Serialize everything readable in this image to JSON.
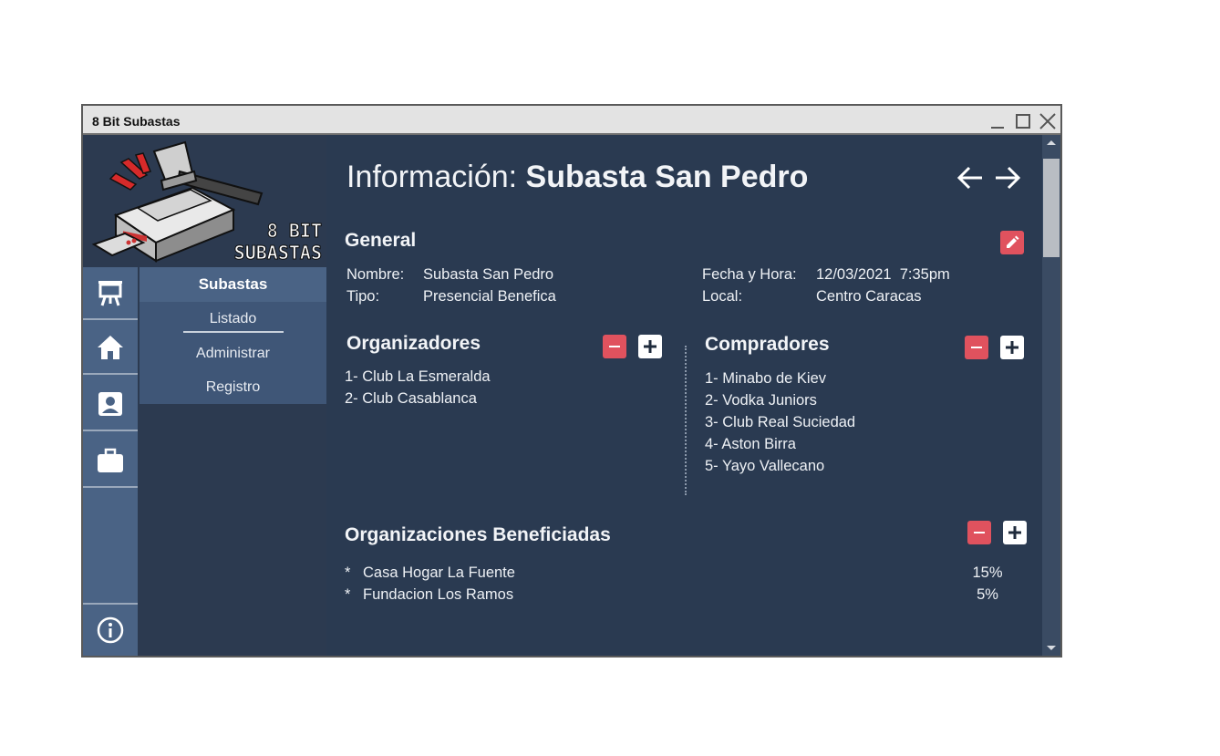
{
  "window": {
    "title": "8 Bit Subastas"
  },
  "logo": {
    "line1": "8 BIT",
    "line2": "SUBASTAS"
  },
  "icons": {
    "rail": [
      "presentation-icon",
      "home-icon",
      "contact-card-icon",
      "briefcase-icon",
      "info-icon"
    ],
    "window": [
      "minimize-icon",
      "maximize-icon",
      "close-icon"
    ]
  },
  "submenu": {
    "title": "Subastas",
    "items": [
      "Listado",
      "Administrar",
      "Registro"
    ]
  },
  "page": {
    "title_prefix": "Información:",
    "title_name": "Subasta San Pedro"
  },
  "general": {
    "heading": "General",
    "nombre_label": "Nombre:",
    "nombre_value": "Subasta San Pedro",
    "tipo_label": "Tipo:",
    "tipo_value": "Presencial Benefica",
    "fecha_label": "Fecha y Hora:",
    "fecha_value": "12/03/2021  7:35pm",
    "local_label": "Local:",
    "local_value": "Centro Caracas"
  },
  "organizadores": {
    "heading": "Organizadores",
    "items": [
      "1- Club La Esmeralda",
      "2- Club Casablanca"
    ]
  },
  "compradores": {
    "heading": "Compradores",
    "items": [
      "1- Minabo de Kiev",
      "2- Vodka Juniors",
      "3- Club Real Suciedad",
      "4- Aston Birra",
      "5- Yayo Vallecano"
    ]
  },
  "beneficiadas": {
    "heading": "Organizaciones Beneficiadas",
    "bullet": "*",
    "items": [
      {
        "name": "Casa Hogar La Fuente",
        "pct": "15%"
      },
      {
        "name": "Fundacion Los Ramos",
        "pct": "5%"
      }
    ]
  },
  "colors": {
    "accent_red": "#e0525e",
    "panel_bg": "#2a3a51",
    "rail_bg": "#4a6385"
  }
}
